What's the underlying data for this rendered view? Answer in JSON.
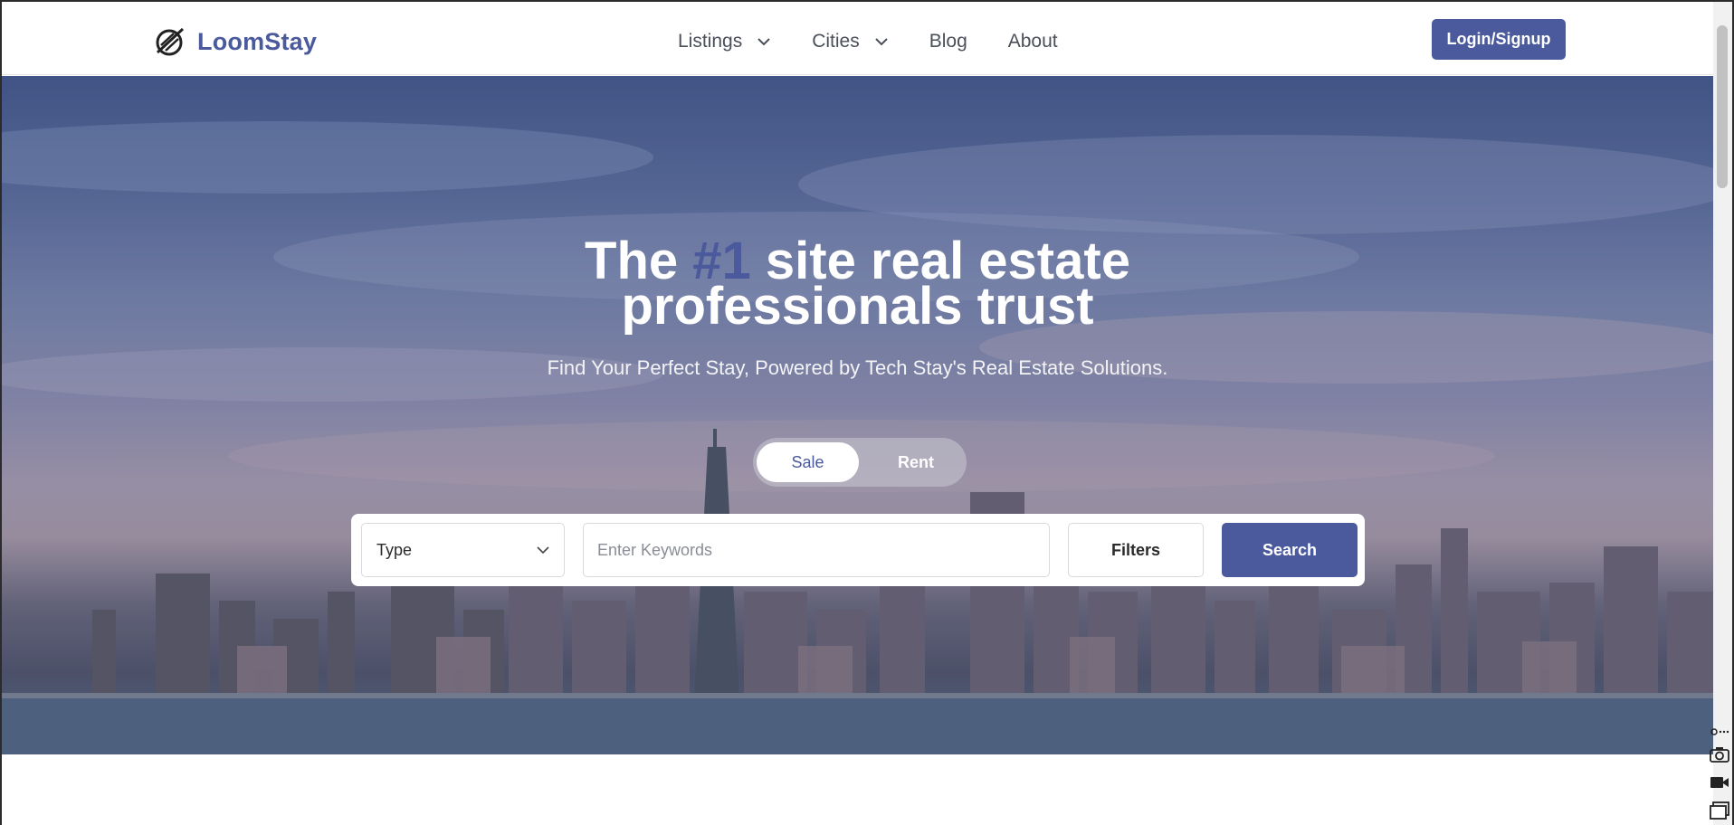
{
  "brand": {
    "name": "LoomStay",
    "color": "#4a5a9c",
    "icon": "logo-slashed-circle-icon"
  },
  "nav": {
    "items": [
      {
        "label": "Listings",
        "has_dropdown": true
      },
      {
        "label": "Cities",
        "has_dropdown": true
      },
      {
        "label": "Blog",
        "has_dropdown": false
      },
      {
        "label": "About",
        "has_dropdown": false
      }
    ],
    "login_label": "Login/Signup"
  },
  "hero": {
    "title_pre": "The",
    "title_accent": "#1",
    "title_post": "site real estate",
    "title_line2": "professionals trust",
    "subtitle": "Find Your Perfect Stay, Powered by Tech Stay's Real Estate Solutions."
  },
  "toggle": {
    "options": [
      "Sale",
      "Rent"
    ],
    "selected": "Sale"
  },
  "search": {
    "type_label": "Type",
    "keyword_placeholder": "Enter Keywords",
    "keyword_value": "",
    "filters_label": "Filters",
    "search_label": "Search"
  },
  "colors": {
    "accent": "#4a5a9c",
    "text": "#4a4f5a"
  }
}
